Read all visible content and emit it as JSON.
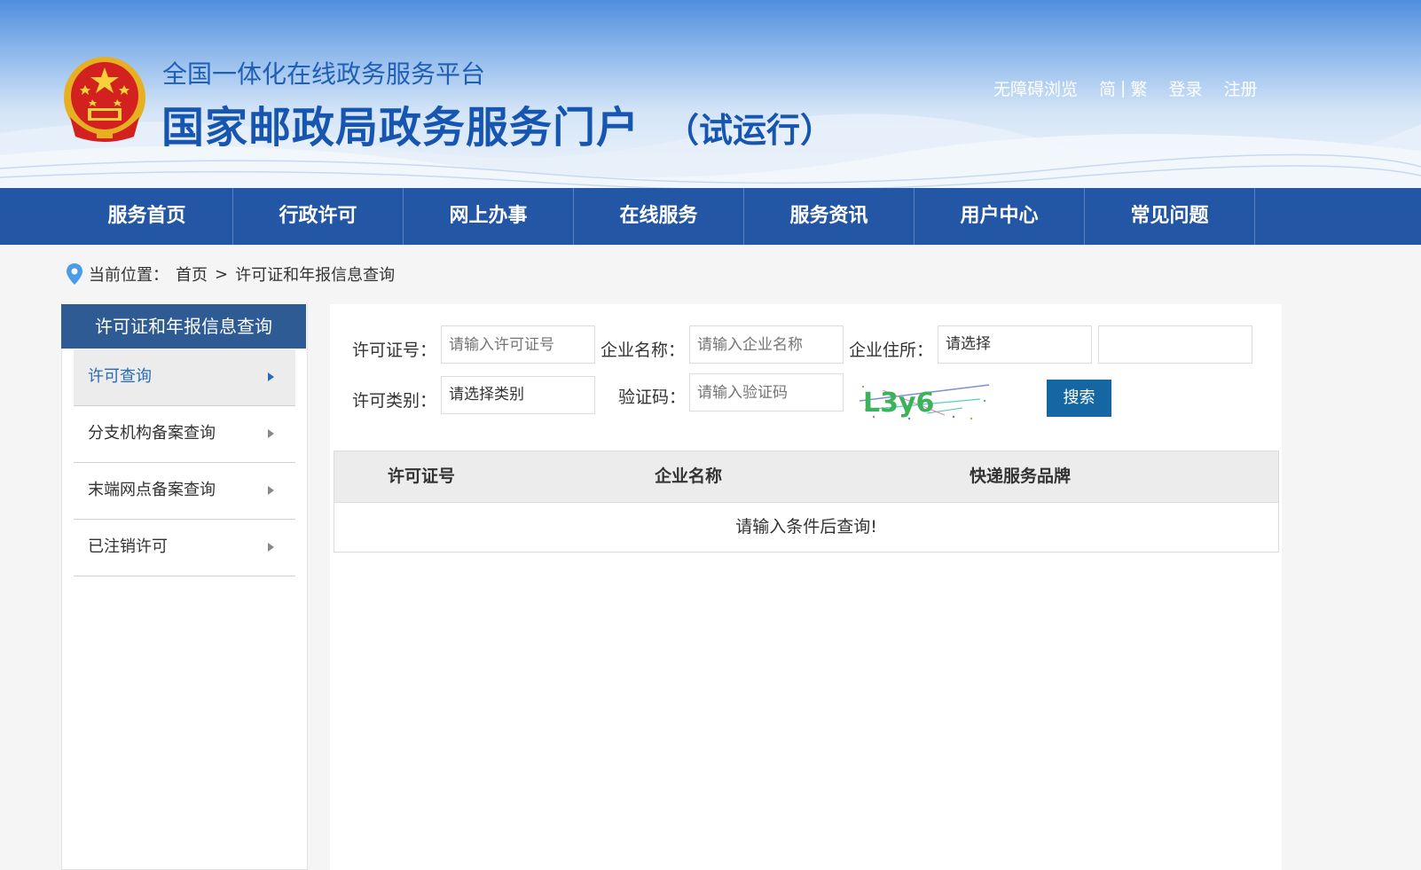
{
  "header": {
    "subtitle": "全国一体化在线政务服务平台",
    "title": "国家邮政局政务服务门户",
    "title_suffix": "（试运行）",
    "links": {
      "accessibility": "无障碍浏览",
      "simplified": "简",
      "separator": "|",
      "traditional": "繁",
      "login": "登录",
      "register": "注册"
    }
  },
  "nav": {
    "items": [
      "服务首页",
      "行政许可",
      "网上办事",
      "在线服务",
      "服务资讯",
      "用户中心",
      "常见问题"
    ]
  },
  "breadcrumb": {
    "label": "当前位置：",
    "home": "首页",
    "arrow": ">",
    "current": "许可证和年报信息查询"
  },
  "sidebar": {
    "title": "许可证和年报信息查询",
    "items": [
      {
        "label": "许可查询",
        "active": true
      },
      {
        "label": "分支机构备案查询",
        "active": false
      },
      {
        "label": "末端网点备案查询",
        "active": false
      },
      {
        "label": "已注销许可",
        "active": false
      }
    ]
  },
  "form": {
    "license_no_label": "许可证号：",
    "license_no_placeholder": "请输入许可证号",
    "company_name_label": "企业名称：",
    "company_name_placeholder": "请输入企业名称",
    "company_address_label": "企业住所：",
    "company_address_value": "请选择",
    "company_address_extra_value": "",
    "license_type_label": "许可类别：",
    "license_type_value": "请选择类别",
    "captcha_label": "验证码：",
    "captcha_placeholder": "请输入验证码",
    "captcha_text": "L3y6",
    "search_button": "搜索"
  },
  "table": {
    "columns": [
      "许可证号",
      "企业名称",
      "快递服务品牌"
    ],
    "empty_message": "请输入条件后查询!"
  },
  "colors": {
    "nav_bg": "#2356a4",
    "sidebar_head": "#2f5b94",
    "button": "#1467a3",
    "title": "#1756b0"
  }
}
